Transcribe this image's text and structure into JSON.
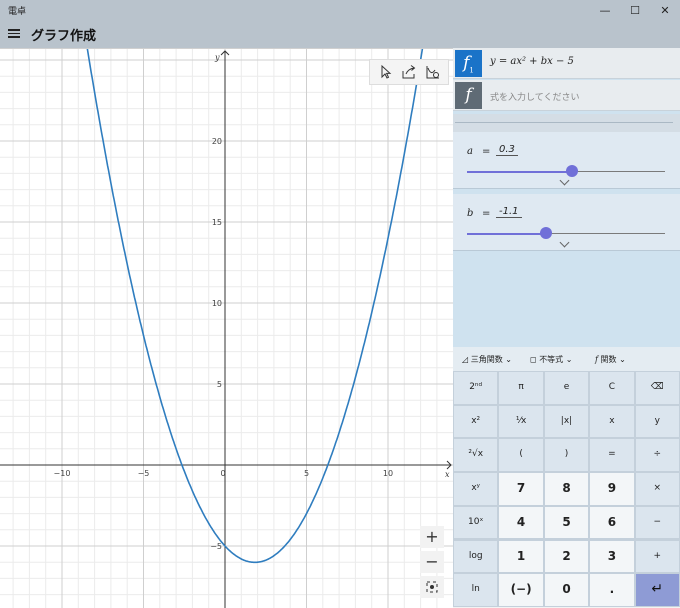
{
  "window": {
    "title": "電卓",
    "minimize": "—",
    "maximize": "☐",
    "close": "✕"
  },
  "header": {
    "title": "グラフ作成",
    "menu_icon": "hamburger-icon"
  },
  "graph": {
    "axis_x_label": "x",
    "axis_y_label": "y",
    "x_ticks": [
      "−10",
      "−5",
      "0",
      "5",
      "10"
    ],
    "y_ticks": [
      "20",
      "15",
      "10",
      "5",
      "−5"
    ],
    "tools": [
      "cursor-icon",
      "share-icon",
      "graph-options-icon"
    ],
    "zoom_in": "+",
    "zoom_out": "−",
    "reset_view_icon": "reset-view-icon",
    "curve_color": "#2f7dbf"
  },
  "functions": [
    {
      "badge": "f",
      "sub": "1",
      "expression": "y = ax² + bx − 5",
      "color": "#1a73c8"
    },
    {
      "badge": "f",
      "sub": "",
      "placeholder": "式を入力してください",
      "color": "#5f6b75"
    }
  ],
  "variables": [
    {
      "name": "a",
      "eq": "=",
      "value": "0.3",
      "slider_fraction": 0.53
    },
    {
      "name": "b",
      "eq": "=",
      "value": "-1.1",
      "slider_fraction": 0.4
    }
  ],
  "categories": [
    {
      "label": "三角関数",
      "icon": "triangle-icon"
    },
    {
      "label": "不等式",
      "icon": "inequality-icon"
    },
    {
      "label": "関数",
      "icon": "function-icon"
    }
  ],
  "keypad": [
    [
      "2ⁿᵈ",
      "π",
      "e",
      "C",
      "⌫"
    ],
    [
      "x²",
      "¹⁄x",
      "|x|",
      "x",
      "y"
    ],
    [
      "²√x",
      "(",
      ")",
      "=",
      "÷"
    ],
    [
      "xʸ",
      "7",
      "8",
      "9",
      "×"
    ],
    [
      "10ˣ",
      "4",
      "5",
      "6",
      "−"
    ],
    [
      "log",
      "1",
      "2",
      "3",
      "+"
    ],
    [
      "ln",
      "(−)",
      "0",
      ".",
      "↵"
    ]
  ],
  "colors": {
    "accent": "#7070d8",
    "enter": "#8e9bd5",
    "header": "#b9c3cc"
  }
}
